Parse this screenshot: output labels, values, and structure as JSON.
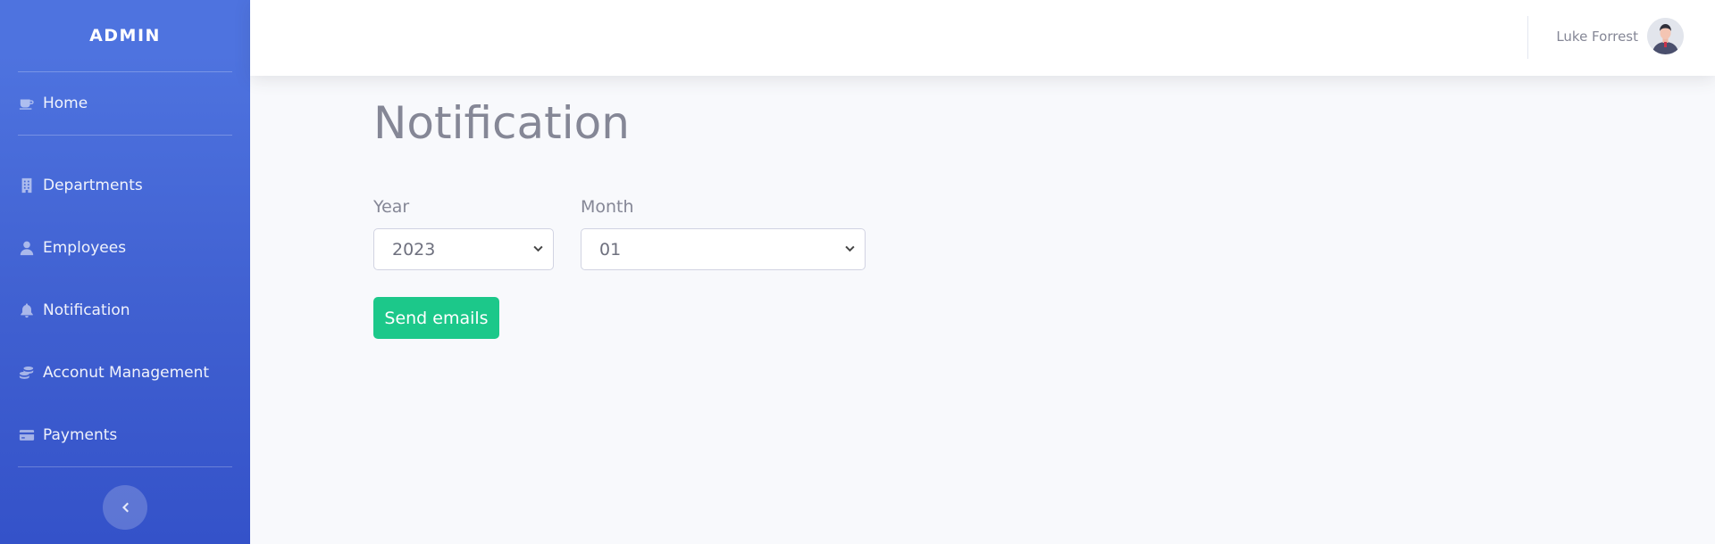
{
  "sidebar": {
    "brand": "ADMIN",
    "items": [
      {
        "label": "Home",
        "icon": "coffee-icon"
      },
      {
        "label": "Departments",
        "icon": "building-icon"
      },
      {
        "label": "Employees",
        "icon": "user-icon"
      },
      {
        "label": "Notification",
        "icon": "bell-icon"
      },
      {
        "label": "Acconut Management",
        "icon": "coins-icon"
      },
      {
        "label": "Payments",
        "icon": "credit-card-icon"
      }
    ],
    "collapse_icon": "chevron-left-icon"
  },
  "topbar": {
    "user_name": "Luke Forrest",
    "avatar_icon": "user-avatar-icon"
  },
  "main": {
    "title": "Notification",
    "year": {
      "label": "Year",
      "selected": "2023"
    },
    "month": {
      "label": "Month",
      "selected": "01"
    },
    "send_button": "Send emails"
  },
  "colors": {
    "sidebar": "#4e73df",
    "success": "#1cc88a",
    "text_muted": "#858796",
    "background": "#f8f9fc"
  }
}
